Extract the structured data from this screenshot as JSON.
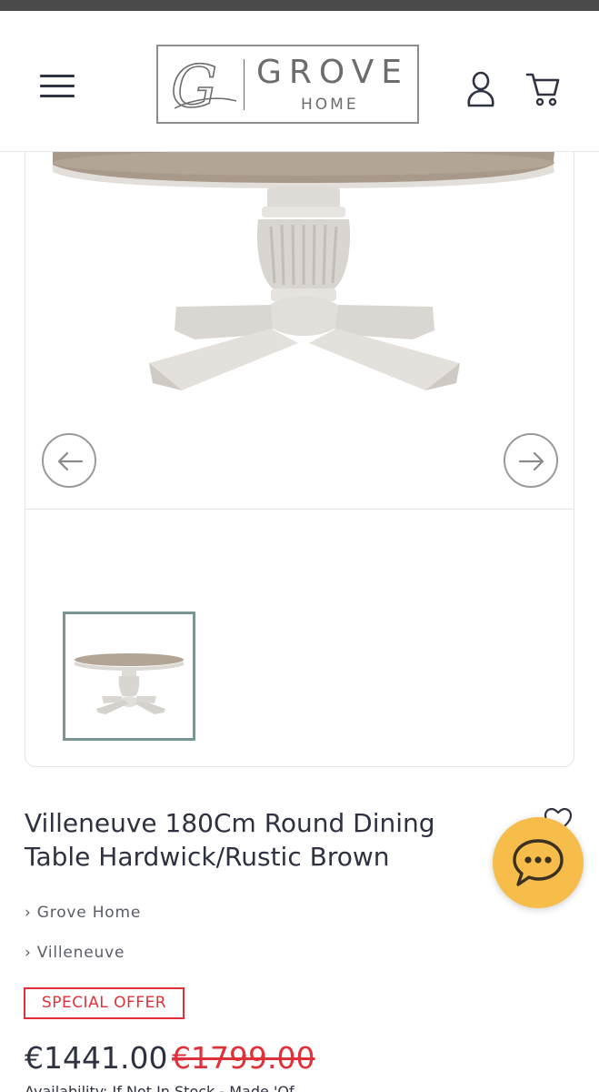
{
  "header": {
    "menu_icon": "hamburger-menu-icon",
    "logo": {
      "monogram": "G",
      "brand": "GROVE",
      "sub": "HOME"
    },
    "account_icon": "user-icon",
    "cart_icon": "cart-icon"
  },
  "gallery": {
    "main_image_alt": "Villeneuve 180Cm Round Dining Table",
    "prev_icon": "arrow-left-icon",
    "next_icon": "arrow-right-icon",
    "thumbnails": 1
  },
  "product": {
    "title": "Villeneuve 180Cm Round Dining Table Hardwick/Rustic Brown",
    "breadcrumbs": [
      "› Grove Home",
      "› Villeneuve"
    ],
    "badge": "SPECIAL OFFER",
    "price": "€1441.00",
    "old_price": "€1799.00",
    "availability": "Availability: If Not In Stock - Made 'Of"
  },
  "colors": {
    "accent_red": "#e0313a",
    "chat_yellow": "#f6bd4b",
    "text_dark": "#2e3140",
    "thumb_border": "#7b9595"
  }
}
